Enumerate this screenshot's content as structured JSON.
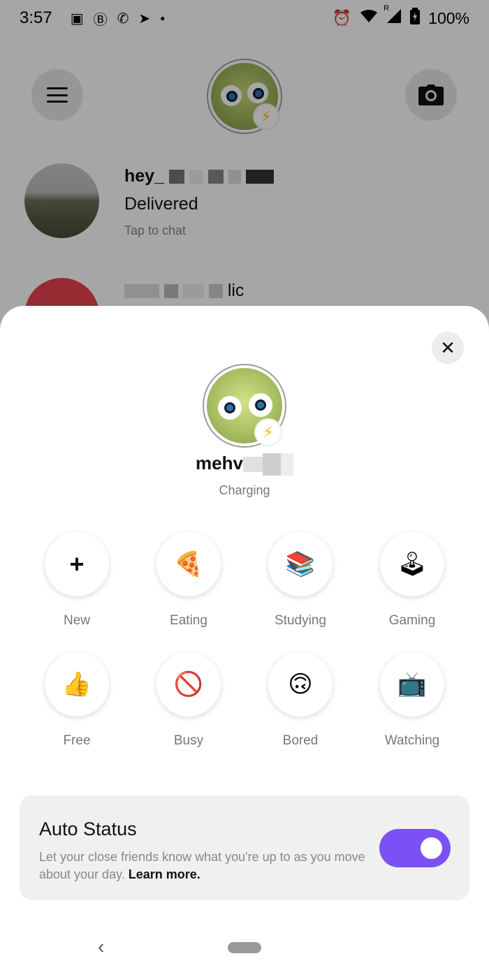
{
  "status_bar": {
    "time": "3:57",
    "left_icons": [
      "image-icon",
      "b-circle-icon",
      "whatsapp-icon",
      "telegram-icon",
      "dot-icon"
    ],
    "right_icons": [
      "alarm-icon",
      "wifi-icon",
      "signal-icon",
      "battery-icon"
    ],
    "roaming": "R",
    "battery": "100%"
  },
  "background": {
    "chats": [
      {
        "name": "hey_",
        "status": "Delivered",
        "hint": "Tap to chat"
      },
      {
        "name": "lic",
        "status": "",
        "hint": ""
      }
    ]
  },
  "sheet": {
    "profile": {
      "name": "mehv",
      "subtitle": "Charging"
    },
    "statuses": [
      {
        "label": "New",
        "icon": "plus-icon",
        "glyph": "+"
      },
      {
        "label": "Eating",
        "icon": "pizza-icon",
        "glyph": "🍕"
      },
      {
        "label": "Studying",
        "icon": "books-icon",
        "glyph": "📚"
      },
      {
        "label": "Gaming",
        "icon": "joystick-icon",
        "glyph": "🕹"
      },
      {
        "label": "Free",
        "icon": "thumbs-up-icon",
        "glyph": "👍"
      },
      {
        "label": "Busy",
        "icon": "no-entry-icon",
        "glyph": "🚫"
      },
      {
        "label": "Bored",
        "icon": "upside-down-face-icon",
        "glyph": "🙃"
      },
      {
        "label": "Watching",
        "icon": "tv-icon",
        "glyph": "📺"
      }
    ],
    "auto_status": {
      "title": "Auto Status",
      "description": "Let your close friends know what you're up to as you move about your day.",
      "link": "Learn more.",
      "enabled": true,
      "toggle_color": "#7b50f5"
    }
  },
  "nav": {
    "back_glyph": "‹"
  }
}
